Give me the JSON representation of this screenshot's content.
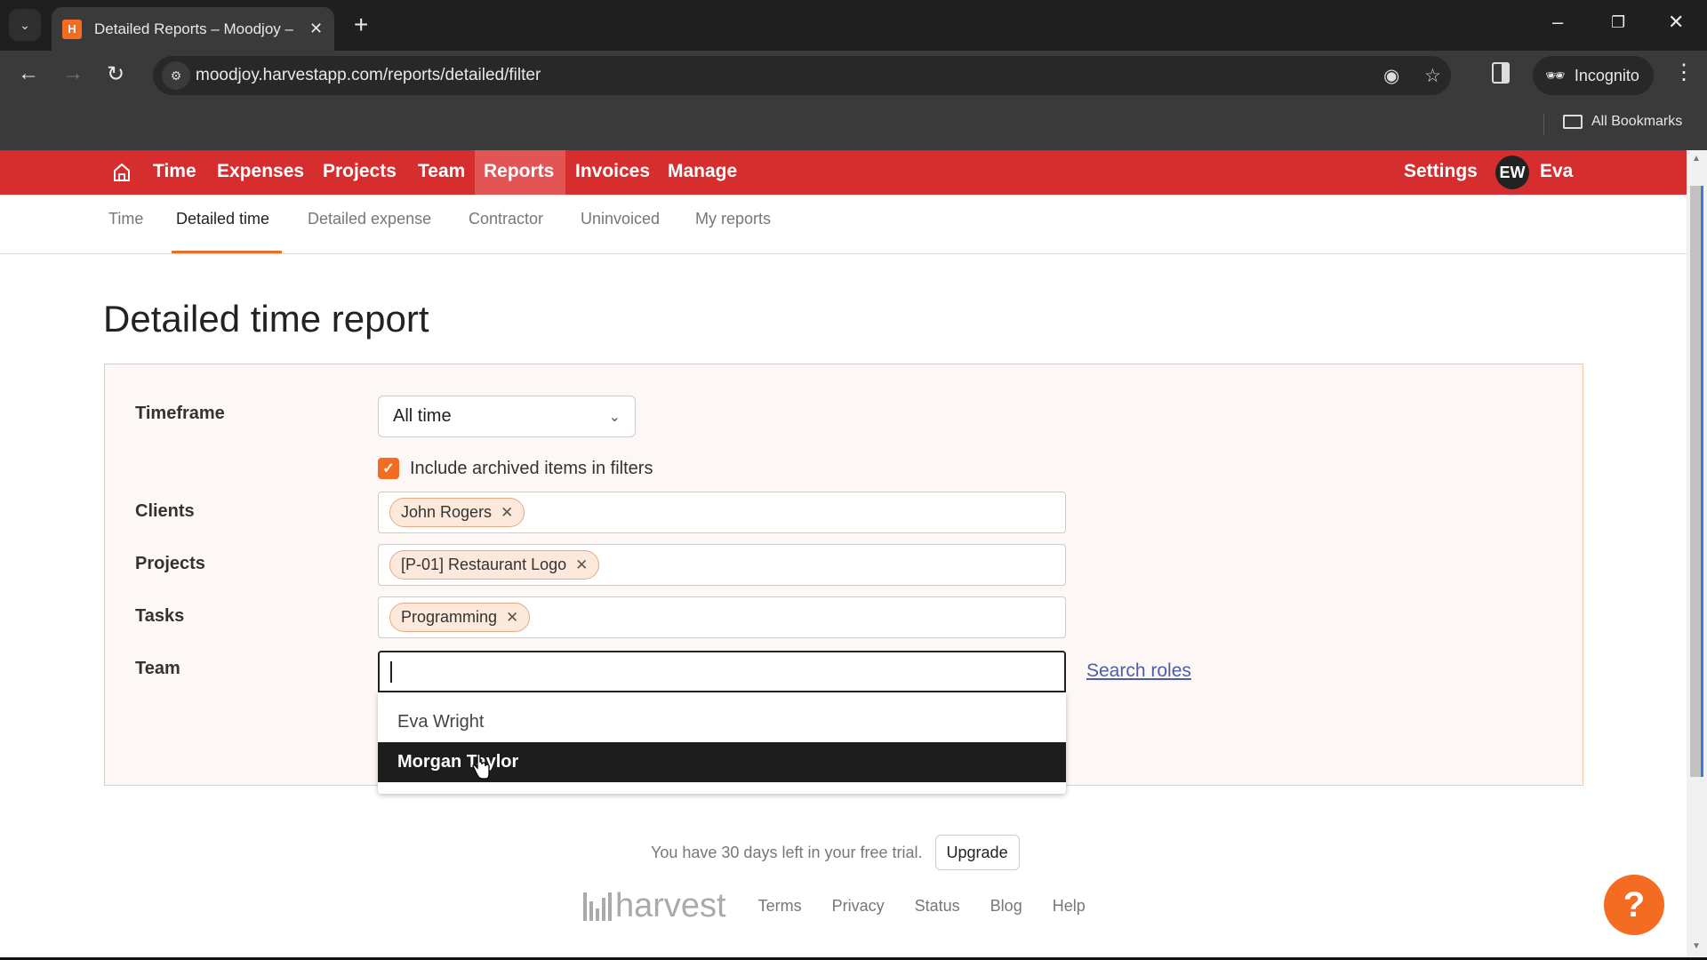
{
  "browser": {
    "tab_title": "Detailed Reports – Moodjoy – H",
    "url": "moodjoy.harvestapp.com/reports/detailed/filter",
    "incognito_label": "Incognito",
    "bookmarks_label": "All Bookmarks"
  },
  "topnav": {
    "items": [
      {
        "label": "Time"
      },
      {
        "label": "Expenses"
      },
      {
        "label": "Projects"
      },
      {
        "label": "Team"
      },
      {
        "label": "Reports",
        "active": true
      },
      {
        "label": "Invoices"
      },
      {
        "label": "Manage"
      }
    ],
    "settings_label": "Settings",
    "avatar_initials": "EW",
    "user_name": "Eva"
  },
  "subnav": {
    "items": [
      {
        "label": "Time"
      },
      {
        "label": "Detailed time",
        "active": true
      },
      {
        "label": "Detailed expense"
      },
      {
        "label": "Contractor"
      },
      {
        "label": "Uninvoiced"
      },
      {
        "label": "My reports"
      }
    ]
  },
  "page_title": "Detailed time report",
  "filters": {
    "timeframe_label": "Timeframe",
    "timeframe_value": "All time",
    "include_archived_label": "Include archived items in filters",
    "include_archived_checked": true,
    "clients_label": "Clients",
    "clients": [
      "John Rogers"
    ],
    "projects_label": "Projects",
    "projects": [
      "[P-01] Restaurant Logo"
    ],
    "tasks_label": "Tasks",
    "tasks": [
      "Programming"
    ],
    "team_label": "Team",
    "team_input_value": "",
    "search_roles_label": "Search roles",
    "team_options": [
      {
        "label": "Eva Wright"
      },
      {
        "label": "Morgan Taylor",
        "highlighted": true
      }
    ]
  },
  "trial": {
    "text": "You have 30 days left in your free trial.",
    "upgrade_label": "Upgrade"
  },
  "footer": {
    "brand": "harvest",
    "links": [
      "Terms",
      "Privacy",
      "Status",
      "Blog",
      "Help"
    ]
  },
  "help_button_label": "?",
  "colors": {
    "brand_red": "#d62e2e",
    "accent_orange": "#f36c21",
    "link_blue": "#4a5fa8"
  }
}
